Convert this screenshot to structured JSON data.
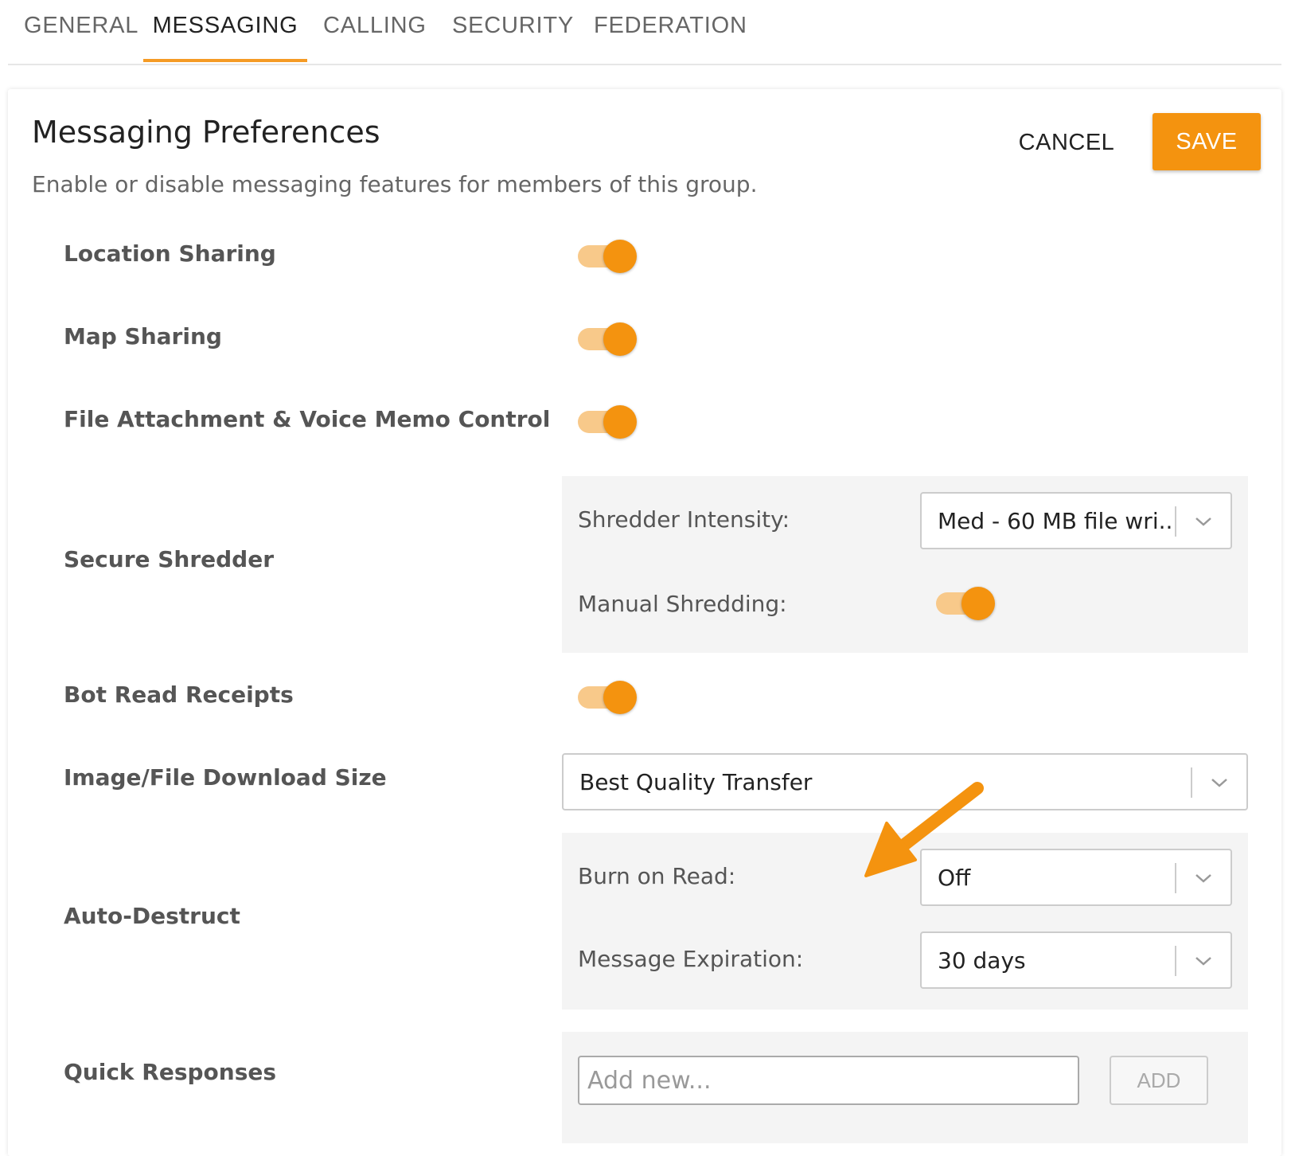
{
  "tabs": [
    {
      "label": "GENERAL"
    },
    {
      "label": "MESSAGING"
    },
    {
      "label": "CALLING"
    },
    {
      "label": "SECURITY"
    },
    {
      "label": "FEDERATION"
    }
  ],
  "active_tab": "MESSAGING",
  "header": {
    "title": "Messaging Preferences",
    "subtitle": "Enable or disable messaging features for members of this group.",
    "cancel_label": "CANCEL",
    "save_label": "SAVE"
  },
  "settings": {
    "location_sharing": {
      "label": "Location Sharing",
      "enabled": true
    },
    "map_sharing": {
      "label": "Map Sharing",
      "enabled": true
    },
    "file_attachment": {
      "label": "File Attachment & Voice Memo Control",
      "enabled": true
    },
    "secure_shredder": {
      "label": "Secure Shredder",
      "intensity_label": "Shredder Intensity:",
      "intensity_value": "Med - 60 MB file wri...",
      "manual_label": "Manual Shredding:",
      "manual_enabled": true
    },
    "bot_read_receipts": {
      "label": "Bot Read Receipts",
      "enabled": true
    },
    "download_size": {
      "label": "Image/File Download Size",
      "value": "Best Quality Transfer"
    },
    "auto_destruct": {
      "label": "Auto-Destruct",
      "burn_label": "Burn on Read:",
      "burn_value": "Off",
      "expiration_label": "Message Expiration:",
      "expiration_value": "30 days"
    },
    "quick_responses": {
      "label": "Quick Responses",
      "placeholder": "Add new...",
      "add_label": "ADD"
    }
  },
  "colors": {
    "accent": "#f4930f",
    "toggle_track": "#f8c98a",
    "panel_bg": "#f4f4f4"
  },
  "icons": {
    "dropdown": "chevron-down-icon",
    "annotation": "arrow-pointer-icon"
  }
}
